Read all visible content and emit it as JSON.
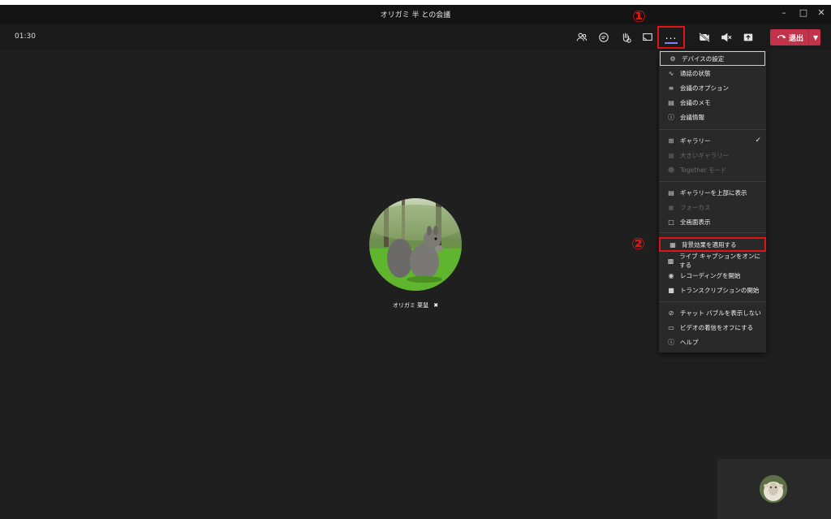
{
  "window": {
    "title": "オリガミ 半 との会議",
    "minimize": "–",
    "maximize": "□",
    "close": "✕"
  },
  "toolbar": {
    "timer": "01:30",
    "more_label": "...",
    "leave_label": "退出"
  },
  "participant": {
    "name": "オリガミ 栗鼠"
  },
  "callouts": {
    "one": "①",
    "two": "②"
  },
  "menu": {
    "items": [
      {
        "label": "デバイスの設定",
        "icon": "gear-icon"
      },
      {
        "label": "通話の状態",
        "icon": "pulse-icon"
      },
      {
        "label": "会議のオプション",
        "icon": "sliders-icon"
      },
      {
        "label": "会議のメモ",
        "icon": "notes-icon"
      },
      {
        "label": "会議情報",
        "icon": "info-icon"
      },
      {
        "label": "ギャラリー",
        "icon": "grid-icon"
      },
      {
        "label": "大きいギャラリー",
        "icon": "large-grid-icon"
      },
      {
        "label": "Together モード",
        "icon": "together-icon"
      },
      {
        "label": "ギャラリーを上部に表示",
        "icon": "top-gallery-icon"
      },
      {
        "label": "フォーカス",
        "icon": "focus-icon"
      },
      {
        "label": "全画面表示",
        "icon": "fullscreen-icon"
      },
      {
        "label": "背景効果を適用する",
        "icon": "background-effects-icon"
      },
      {
        "label": "ライブ キャプションをオンにする",
        "icon": "cc-icon"
      },
      {
        "label": "レコーディングを開始",
        "icon": "record-icon"
      },
      {
        "label": "トランスクリプションの開始",
        "icon": "transcript-icon"
      },
      {
        "label": "チャット バブルを表示しない",
        "icon": "chat-bubble-off-icon"
      },
      {
        "label": "ビデオの着信をオフにする",
        "icon": "video-off-icon"
      },
      {
        "label": "ヘルプ",
        "icon": "help-icon"
      }
    ]
  },
  "colors": {
    "accent": "#7f85f5",
    "leave": "#c4314b",
    "annotation": "#e01515"
  }
}
